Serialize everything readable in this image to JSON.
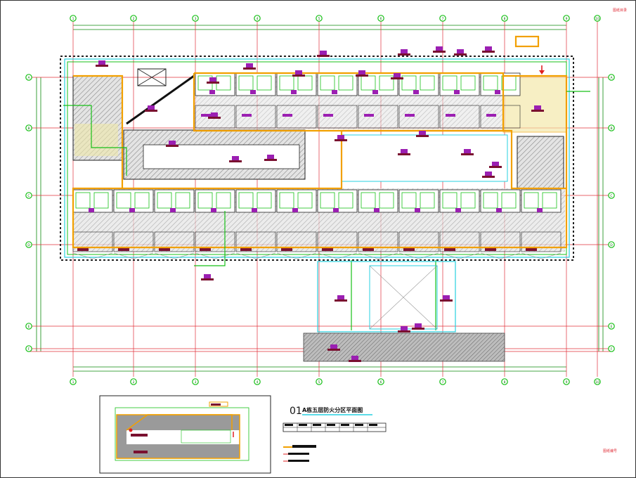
{
  "drawing": {
    "sheet_tag_top": "图纸目录",
    "sheet_tag_bottom": "图纸编号",
    "title_number": "01",
    "title_text": "A栋五层防火分区平面图"
  },
  "grid": {
    "top_axes": [
      "1",
      "2",
      "3",
      "4",
      "5",
      "6",
      "7",
      "8",
      "9",
      "10"
    ],
    "bottom_axes": [
      "1",
      "2",
      "3",
      "4",
      "5",
      "6",
      "7",
      "8",
      "9",
      "10"
    ],
    "left_axes": [
      "A",
      "B",
      "C",
      "D",
      "E",
      "F"
    ],
    "right_axes": [
      "A",
      "B",
      "C",
      "D",
      "E",
      "F"
    ]
  },
  "colors": {
    "grid_line": "#e0303a",
    "axis_bubble": "#18c018",
    "fire_zone": "#f2a000",
    "room_label": "#9b1fb2",
    "wall": "#222222",
    "hatch": "#9a9a9a",
    "cyan": "#27d0e0"
  }
}
